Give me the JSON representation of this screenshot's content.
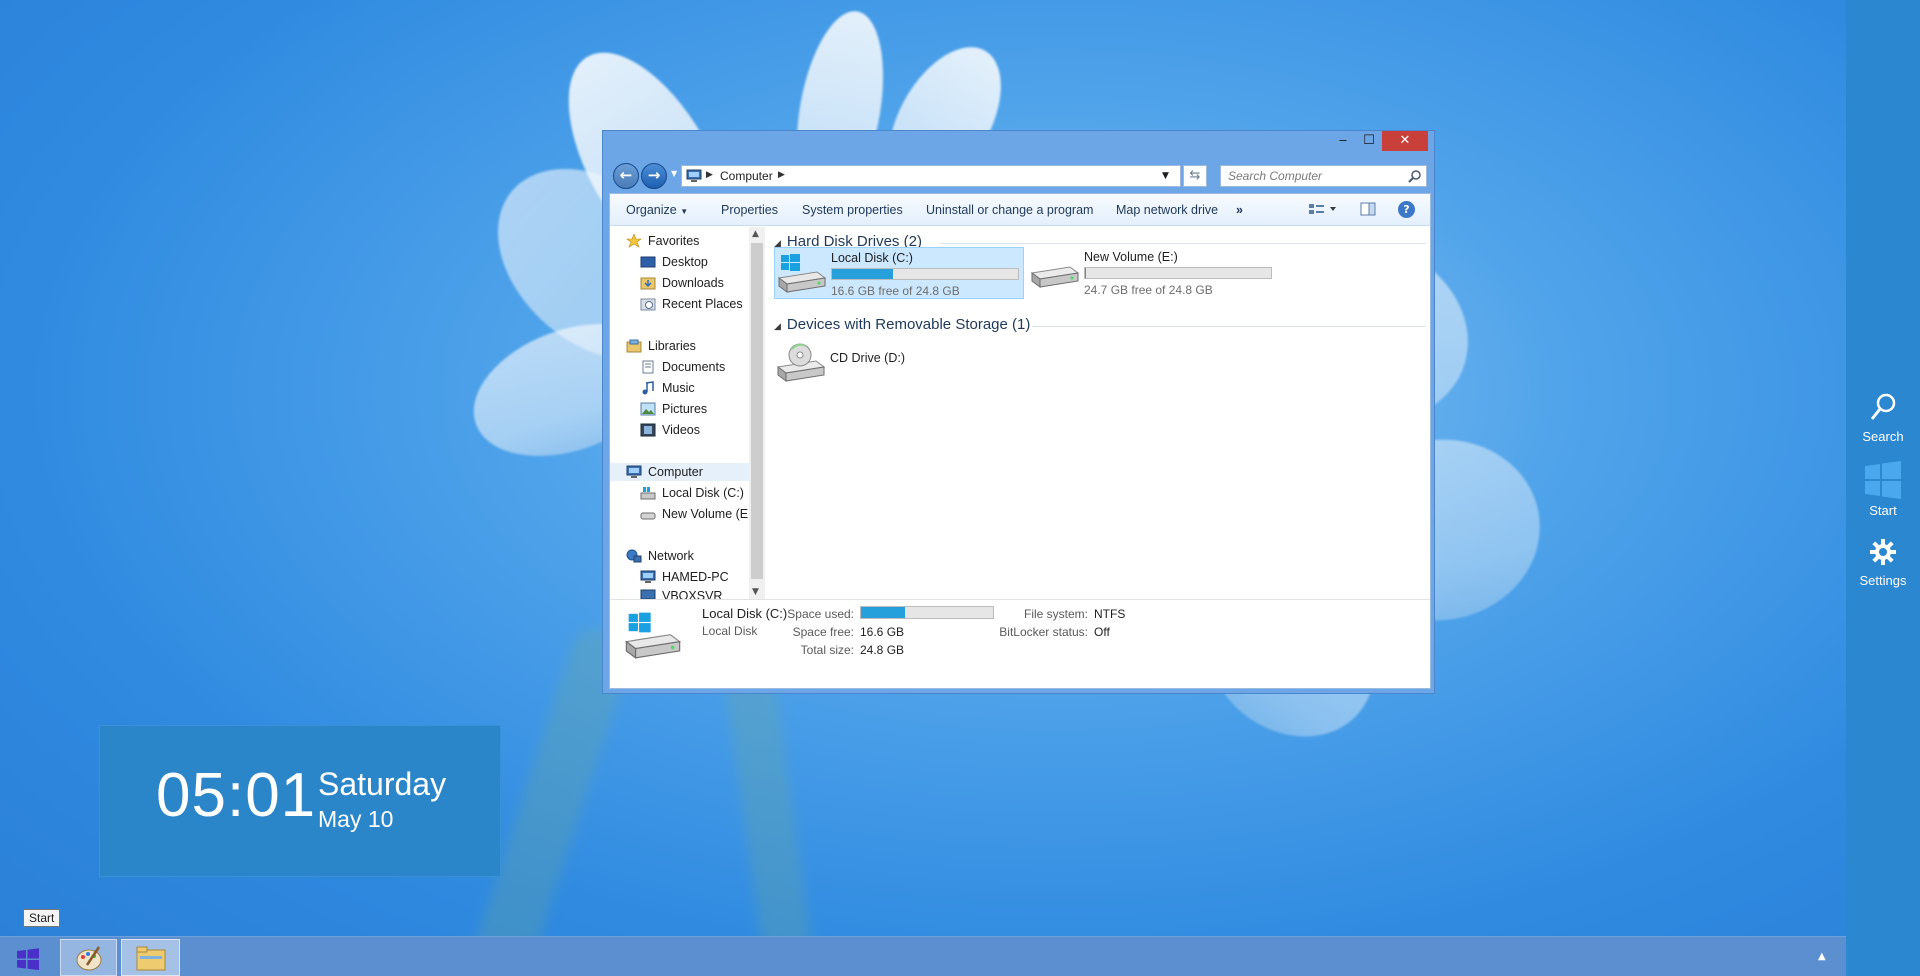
{
  "window": {
    "controls": {
      "minimize": "‒",
      "maximize": "☐",
      "close": "✕"
    },
    "address": {
      "segments": [
        "Computer"
      ]
    },
    "search": {
      "placeholder": "Search Computer"
    }
  },
  "toolbar": {
    "organize": "Organize",
    "properties": "Properties",
    "system_properties": "System properties",
    "uninstall": "Uninstall or change a program",
    "map_network": "Map network drive",
    "more": "»"
  },
  "nav_pane": {
    "favorites": {
      "label": "Favorites",
      "items": [
        "Desktop",
        "Downloads",
        "Recent Places"
      ]
    },
    "libraries": {
      "label": "Libraries",
      "items": [
        "Documents",
        "Music",
        "Pictures",
        "Videos"
      ]
    },
    "computer": {
      "label": "Computer",
      "items": [
        "Local Disk (C:)",
        "New Volume (E:)"
      ]
    },
    "network": {
      "label": "Network",
      "items": [
        "HAMED-PC",
        "VBOXSVR"
      ]
    }
  },
  "content": {
    "groups": [
      {
        "title": "Hard Disk Drives (2)",
        "items": [
          {
            "name": "Local Disk (C:)",
            "free_text": "16.6 GB free of 24.8 GB",
            "used_fraction": 0.33,
            "selected": true
          },
          {
            "name": "New Volume (E:)",
            "free_text": "24.7 GB free of 24.8 GB",
            "used_fraction": 0.004,
            "selected": false
          }
        ]
      },
      {
        "title": "Devices with Removable Storage (1)",
        "items": [
          {
            "name": "CD Drive (D:)"
          }
        ]
      }
    ]
  },
  "details": {
    "name": "Local Disk (C:)",
    "type": "Local Disk",
    "space_used_label": "Space used:",
    "space_used_fraction": 0.33,
    "space_free_label": "Space free:",
    "space_free": "16.6 GB",
    "total_size_label": "Total size:",
    "total_size": "24.8 GB",
    "file_system_label": "File system:",
    "file_system": "NTFS",
    "bitlocker_label": "BitLocker status:",
    "bitlocker": "Off"
  },
  "clock": {
    "time": "05:01",
    "day": "Saturday",
    "date": "May 10"
  },
  "charms": {
    "search": "Search",
    "start": "Start",
    "settings": "Settings"
  },
  "taskbar": {
    "start_tooltip": "Start",
    "tray_arrow": "▲"
  },
  "colors": {
    "accent": "#2a87d0",
    "progress": "#26a0da",
    "close_button": "#c9403a",
    "selection": "#cce8ff"
  }
}
